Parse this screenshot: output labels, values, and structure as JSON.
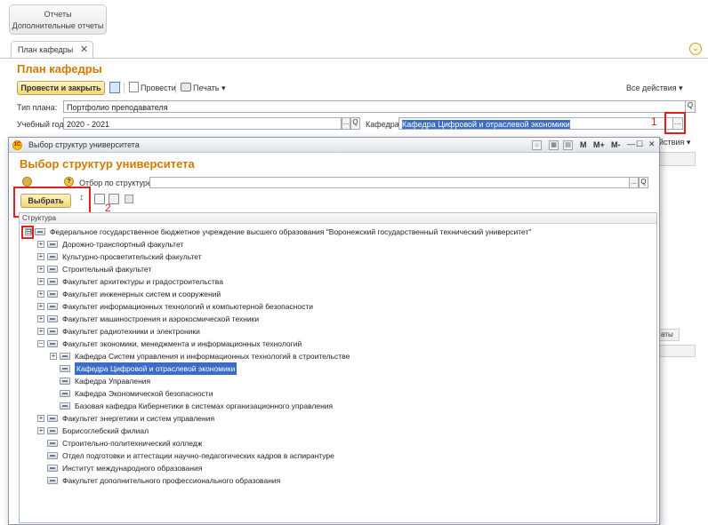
{
  "top_menu": {
    "item1": "Отчеты",
    "item2": "Дополнительные отчеты"
  },
  "tab": {
    "label": "План кафедры",
    "close": "✕"
  },
  "main": {
    "title": "План кафедры",
    "toolbar": {
      "post_close": "Провести и закрыть",
      "post": "Провести",
      "print": "Печать ▾",
      "all_actions": "Все действия ▾",
      "all_actions_2": "йствия ▾"
    },
    "plan_type": {
      "label": "Тип плана:",
      "value": "Портфолио преподавателя"
    },
    "year": {
      "label": "Учебный год:",
      "value": "2020 - 2021"
    },
    "department": {
      "label": "Кафедра:",
      "value": "Кафедра Цифровой и отраслевой экономики"
    },
    "dots": "...",
    "search": "Q",
    "marker1": "1",
    "side_tab": "аты"
  },
  "dialog": {
    "window_title": "Выбор структур университета",
    "title": "Выбор структур университета",
    "window_buttons": {
      "m": "M",
      "mplus": "M+",
      "mminus": "M-",
      "minimize": "—",
      "maximize": "☐",
      "close": "✕"
    },
    "filter_label": "Отбор по структуре:",
    "help": "?",
    "select_button": "Выбрать",
    "marker2": "2",
    "column_header": "Структура",
    "tree": [
      {
        "level": 0,
        "expander": "⊟",
        "text": "Федеральное государственное бюджетное учреждение высшего образования \"Воронежский государственный технический университет\""
      },
      {
        "level": 1,
        "expander": "+",
        "text": "Дорожно-транспортный факультет"
      },
      {
        "level": 1,
        "expander": "+",
        "text": "Культурно-просветительский факультет"
      },
      {
        "level": 1,
        "expander": "+",
        "text": "Строительный факультет"
      },
      {
        "level": 1,
        "expander": "+",
        "text": "Факультет архитектуры и градостроительства"
      },
      {
        "level": 1,
        "expander": "+",
        "text": "Факультет инженерных систем и сооружений"
      },
      {
        "level": 1,
        "expander": "+",
        "text": "Факультет информационных технологий и компьютерной безопасности"
      },
      {
        "level": 1,
        "expander": "+",
        "text": "Факультет машиностроения и аэрокосмической техники"
      },
      {
        "level": 1,
        "expander": "+",
        "text": "Факультет радиотехники и электроники"
      },
      {
        "level": 1,
        "expander": "−",
        "text": "Факультет экономики, менеджмента и информационных технологий"
      },
      {
        "level": 2,
        "expander": "+",
        "text": "Кафедра Систем управления и информационных технологий в строительстве"
      },
      {
        "level": 2,
        "expander": "",
        "text": "Кафедра Цифровой и отраслевой экономики",
        "selected": true
      },
      {
        "level": 2,
        "expander": "",
        "text": "Кафедра Управления"
      },
      {
        "level": 2,
        "expander": "",
        "text": "Кафедра Экономической безопасности"
      },
      {
        "level": 2,
        "expander": "",
        "text": "Базовая кафедра Кибернетики в системах организационного управления"
      },
      {
        "level": 1,
        "expander": "+",
        "text": "Факультет энергетики и систем управления"
      },
      {
        "level": 1,
        "expander": "+",
        "text": "Борисоглебский филиал"
      },
      {
        "level": 1,
        "expander": "",
        "text": "Строительно-политехнический колледж"
      },
      {
        "level": 1,
        "expander": "",
        "text": "Отдел подготовки и аттестации научно-педагогических кадров в аспирантуре"
      },
      {
        "level": 1,
        "expander": "",
        "text": "Институт международного образования"
      },
      {
        "level": 1,
        "expander": "",
        "text": "Факультет дополнительного профессионального образования"
      }
    ]
  }
}
